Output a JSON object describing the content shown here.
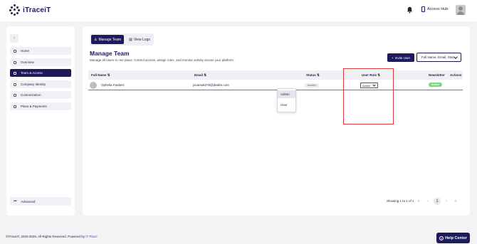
{
  "brand": {
    "logo_text": "iTraceiT"
  },
  "header": {
    "access_hub_label": "Access Hub"
  },
  "sidebar": {
    "collapse_icon": "chevron-left-icon",
    "items": [
      {
        "label": "Home",
        "icon": "home-icon"
      },
      {
        "label": "Overview",
        "icon": "grid-icon"
      },
      {
        "label": "Team & Access",
        "icon": "users-icon",
        "active": true
      },
      {
        "label": "Company Identity",
        "icon": "globe-icon"
      },
      {
        "label": "Customization",
        "icon": "sliders-icon"
      },
      {
        "label": "Plans & Payments",
        "icon": "dollar-icon"
      }
    ],
    "advanced_label": "Advanced"
  },
  "tabs": {
    "manage_team": "Manage Team",
    "view_logs": "View Logs"
  },
  "page": {
    "title": "Manage Team",
    "subtitle": "Manage all users in one place. Control access, assign roles, and monitor activity across your platform."
  },
  "toolbar": {
    "invite_label": "Invite User",
    "filter_value": "Full Name, Email, Stat..."
  },
  "table": {
    "headers": {
      "full_name": "Full Name",
      "email": "Email",
      "status": "Status",
      "user_role": "User Role",
      "newsletter": "Newsletter",
      "actions": "Actions"
    },
    "rows": [
      {
        "full_name": "Ophelia Faubert",
        "email": "jocamak275@dealm.com",
        "status": "Inactive",
        "role": "Admin",
        "newsletter": "Active"
      }
    ]
  },
  "role_dropdown": {
    "options": [
      "Admin",
      "User"
    ],
    "selected": "Admin"
  },
  "pagination": {
    "summary": "Showing 1 to 1 of 1",
    "first": "«",
    "prev": "‹",
    "current": "1",
    "next": "›",
    "last": "»"
  },
  "footer": {
    "copyright": "©iTraceiT, 2020-2025. All Rights Reserved. Powered by ",
    "powered_by": "IT Place"
  },
  "help_button": {
    "label": "Help Center"
  },
  "colors": {
    "brand": "#1e1b5c",
    "active_badge": "#7cd67a",
    "highlight": "#d83a3a"
  }
}
